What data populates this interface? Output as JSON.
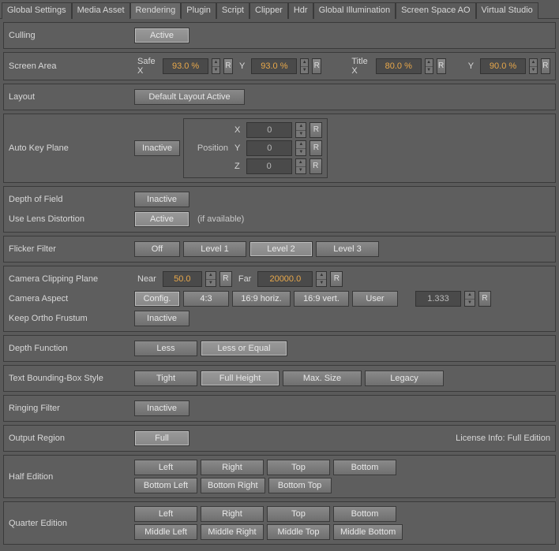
{
  "tabs": [
    "Global Settings",
    "Media Asset",
    "Rendering",
    "Plugin",
    "Script",
    "Clipper",
    "Hdr",
    "Global Illumination",
    "Screen Space AO",
    "Virtual Studio"
  ],
  "activeTab": 2,
  "culling": {
    "label": "Culling",
    "button": "Active"
  },
  "screenArea": {
    "label": "Screen Area",
    "safeX": "Safe X",
    "safeXVal": "93.0 %",
    "y1": "Y",
    "y1Val": "93.0 %",
    "titleX": "Title X",
    "titleXVal": "80.0 %",
    "y2": "Y",
    "y2Val": "90.0 %"
  },
  "layout": {
    "label": "Layout",
    "button": "Default Layout Active"
  },
  "autoKeyPlane": {
    "label": "Auto Key Plane",
    "button": "Inactive",
    "posLabel": "Position",
    "x": "X",
    "xv": "0",
    "y": "Y",
    "yv": "0",
    "z": "Z",
    "zv": "0"
  },
  "dof": {
    "label": "Depth of Field",
    "button": "Inactive"
  },
  "lensDist": {
    "label": "Use Lens Distortion",
    "button": "Active",
    "hint": "(if available)"
  },
  "flicker": {
    "label": "Flicker Filter",
    "opts": [
      "Off",
      "Level 1",
      "Level 2",
      "Level 3"
    ],
    "sel": 2
  },
  "clipPlane": {
    "label": "Camera Clipping Plane",
    "near": "Near",
    "nearVal": "50.0",
    "far": "Far",
    "farVal": "20000.0"
  },
  "camAspect": {
    "label": "Camera Aspect",
    "opts": [
      "Config.",
      "4:3",
      "16:9 horiz.",
      "16:9 vert.",
      "User"
    ],
    "sel": 0,
    "val": "1.333"
  },
  "keepOrtho": {
    "label": "Keep Ortho Frustum",
    "button": "Inactive"
  },
  "depthFunc": {
    "label": "Depth Function",
    "opts": [
      "Less",
      "Less or Equal"
    ],
    "sel": 1
  },
  "textBB": {
    "label": "Text Bounding-Box Style",
    "opts": [
      "Tight",
      "Full Height",
      "Max. Size",
      "Legacy"
    ],
    "sel": 1
  },
  "ringing": {
    "label": "Ringing Filter",
    "button": "Inactive"
  },
  "outRegion": {
    "label": "Output Region",
    "button": "Full",
    "info": "License Info: Full Edition"
  },
  "halfEd": {
    "label": "Half Edition",
    "row1": [
      "Left",
      "Right",
      "Top",
      "Bottom"
    ],
    "row2": [
      "Bottom Left",
      "Bottom Right",
      "Bottom Top"
    ]
  },
  "quartEd": {
    "label": "Quarter Edition",
    "row1": [
      "Left",
      "Right",
      "Top",
      "Bottom"
    ],
    "row2": [
      "Middle Left",
      "Middle Right",
      "Middle Top",
      "Middle Bottom"
    ]
  },
  "R": "R"
}
